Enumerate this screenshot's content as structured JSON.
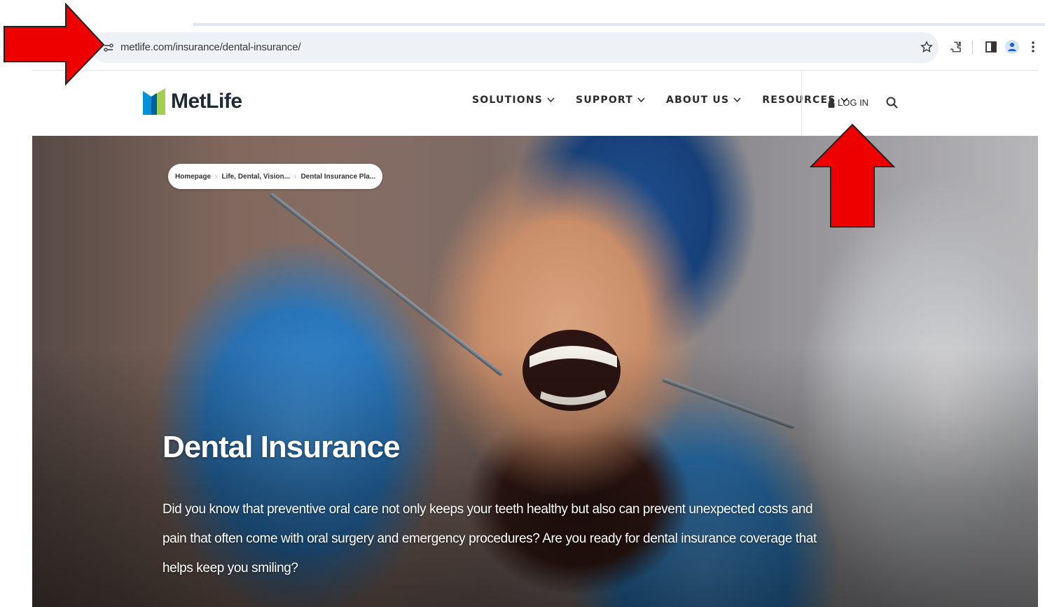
{
  "browser": {
    "url": "metlife.com/insurance/dental-insurance/",
    "toolbar_icons": [
      "star-icon",
      "extensions-icon",
      "sidebar-icon",
      "profile-icon",
      "menu-dots-icon"
    ]
  },
  "header": {
    "logo_text": "MetLife",
    "nav": [
      {
        "label": "SOLUTIONS"
      },
      {
        "label": "SUPPORT"
      },
      {
        "label": "ABOUT US"
      },
      {
        "label": "RESOURCES"
      }
    ],
    "login_label": "LOG IN"
  },
  "hero": {
    "breadcrumb": [
      "Homepage",
      "Life, Dental, Vision...",
      "Dental Insurance Pla..."
    ],
    "title": "Dental Insurance",
    "body": "Did you know that preventive oral care not only keeps your teeth healthy but also can prevent unexpected costs and pain that often come with oral surgery and emergency procedures? Are you ready for dental insurance coverage that helps keep you smiling?"
  },
  "colors": {
    "annotation_red": "#ee0000",
    "logo_blue": "#0090da",
    "logo_green": "#a4ce4e"
  }
}
